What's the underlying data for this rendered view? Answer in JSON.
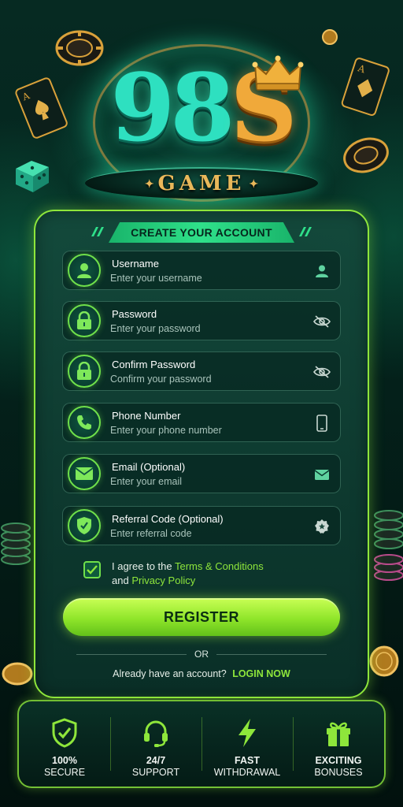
{
  "brand": {
    "logo_text_left": "98",
    "logo_text_right": "S",
    "subtitle": "GAME"
  },
  "form": {
    "title": "CREATE YOUR ACCOUNT",
    "fields": [
      {
        "label": "Username",
        "placeholder": "Enter your username",
        "icon": "user-icon",
        "right_icon": "user-icon"
      },
      {
        "label": "Password",
        "placeholder": "Enter your password",
        "icon": "lock-icon",
        "right_icon": "eye-off-icon"
      },
      {
        "label": "Confirm Password",
        "placeholder": "Confirm your password",
        "icon": "lock-icon",
        "right_icon": "eye-off-icon"
      },
      {
        "label": "Phone Number",
        "placeholder": "Enter your phone number",
        "icon": "phone-icon",
        "right_icon": "mobile-icon"
      },
      {
        "label": "Email (Optional)",
        "placeholder": "Enter your email",
        "icon": "mail-icon",
        "right_icon": "mail-icon"
      },
      {
        "label": "Referral Code (Optional)",
        "placeholder": "Enter referral code",
        "icon": "shield-check-icon",
        "right_icon": "badge-star-icon"
      }
    ],
    "agree": {
      "checked": true,
      "prefix": "I agree to the ",
      "terms_link": "Terms & Conditions",
      "middle": "and ",
      "privacy_link": "Privacy Policy"
    },
    "register_label": "REGISTER",
    "or_label": "OR",
    "login_prompt": "Already have an account?",
    "login_link": "LOGIN NOW"
  },
  "features": [
    {
      "line1": "100%",
      "line2": "SECURE",
      "icon": "shield-check-icon"
    },
    {
      "line1": "24/7",
      "line2": "SUPPORT",
      "icon": "headset-icon"
    },
    {
      "line1": "FAST",
      "line2": "WITHDRAWAL",
      "icon": "lightning-icon"
    },
    {
      "line1": "EXCITING",
      "line2": "BONUSES",
      "icon": "gift-icon"
    }
  ],
  "colors": {
    "accent_green": "#8ee63b",
    "teal": "#2ee0c0",
    "gold": "#f0a93a",
    "background": "#04241d"
  }
}
